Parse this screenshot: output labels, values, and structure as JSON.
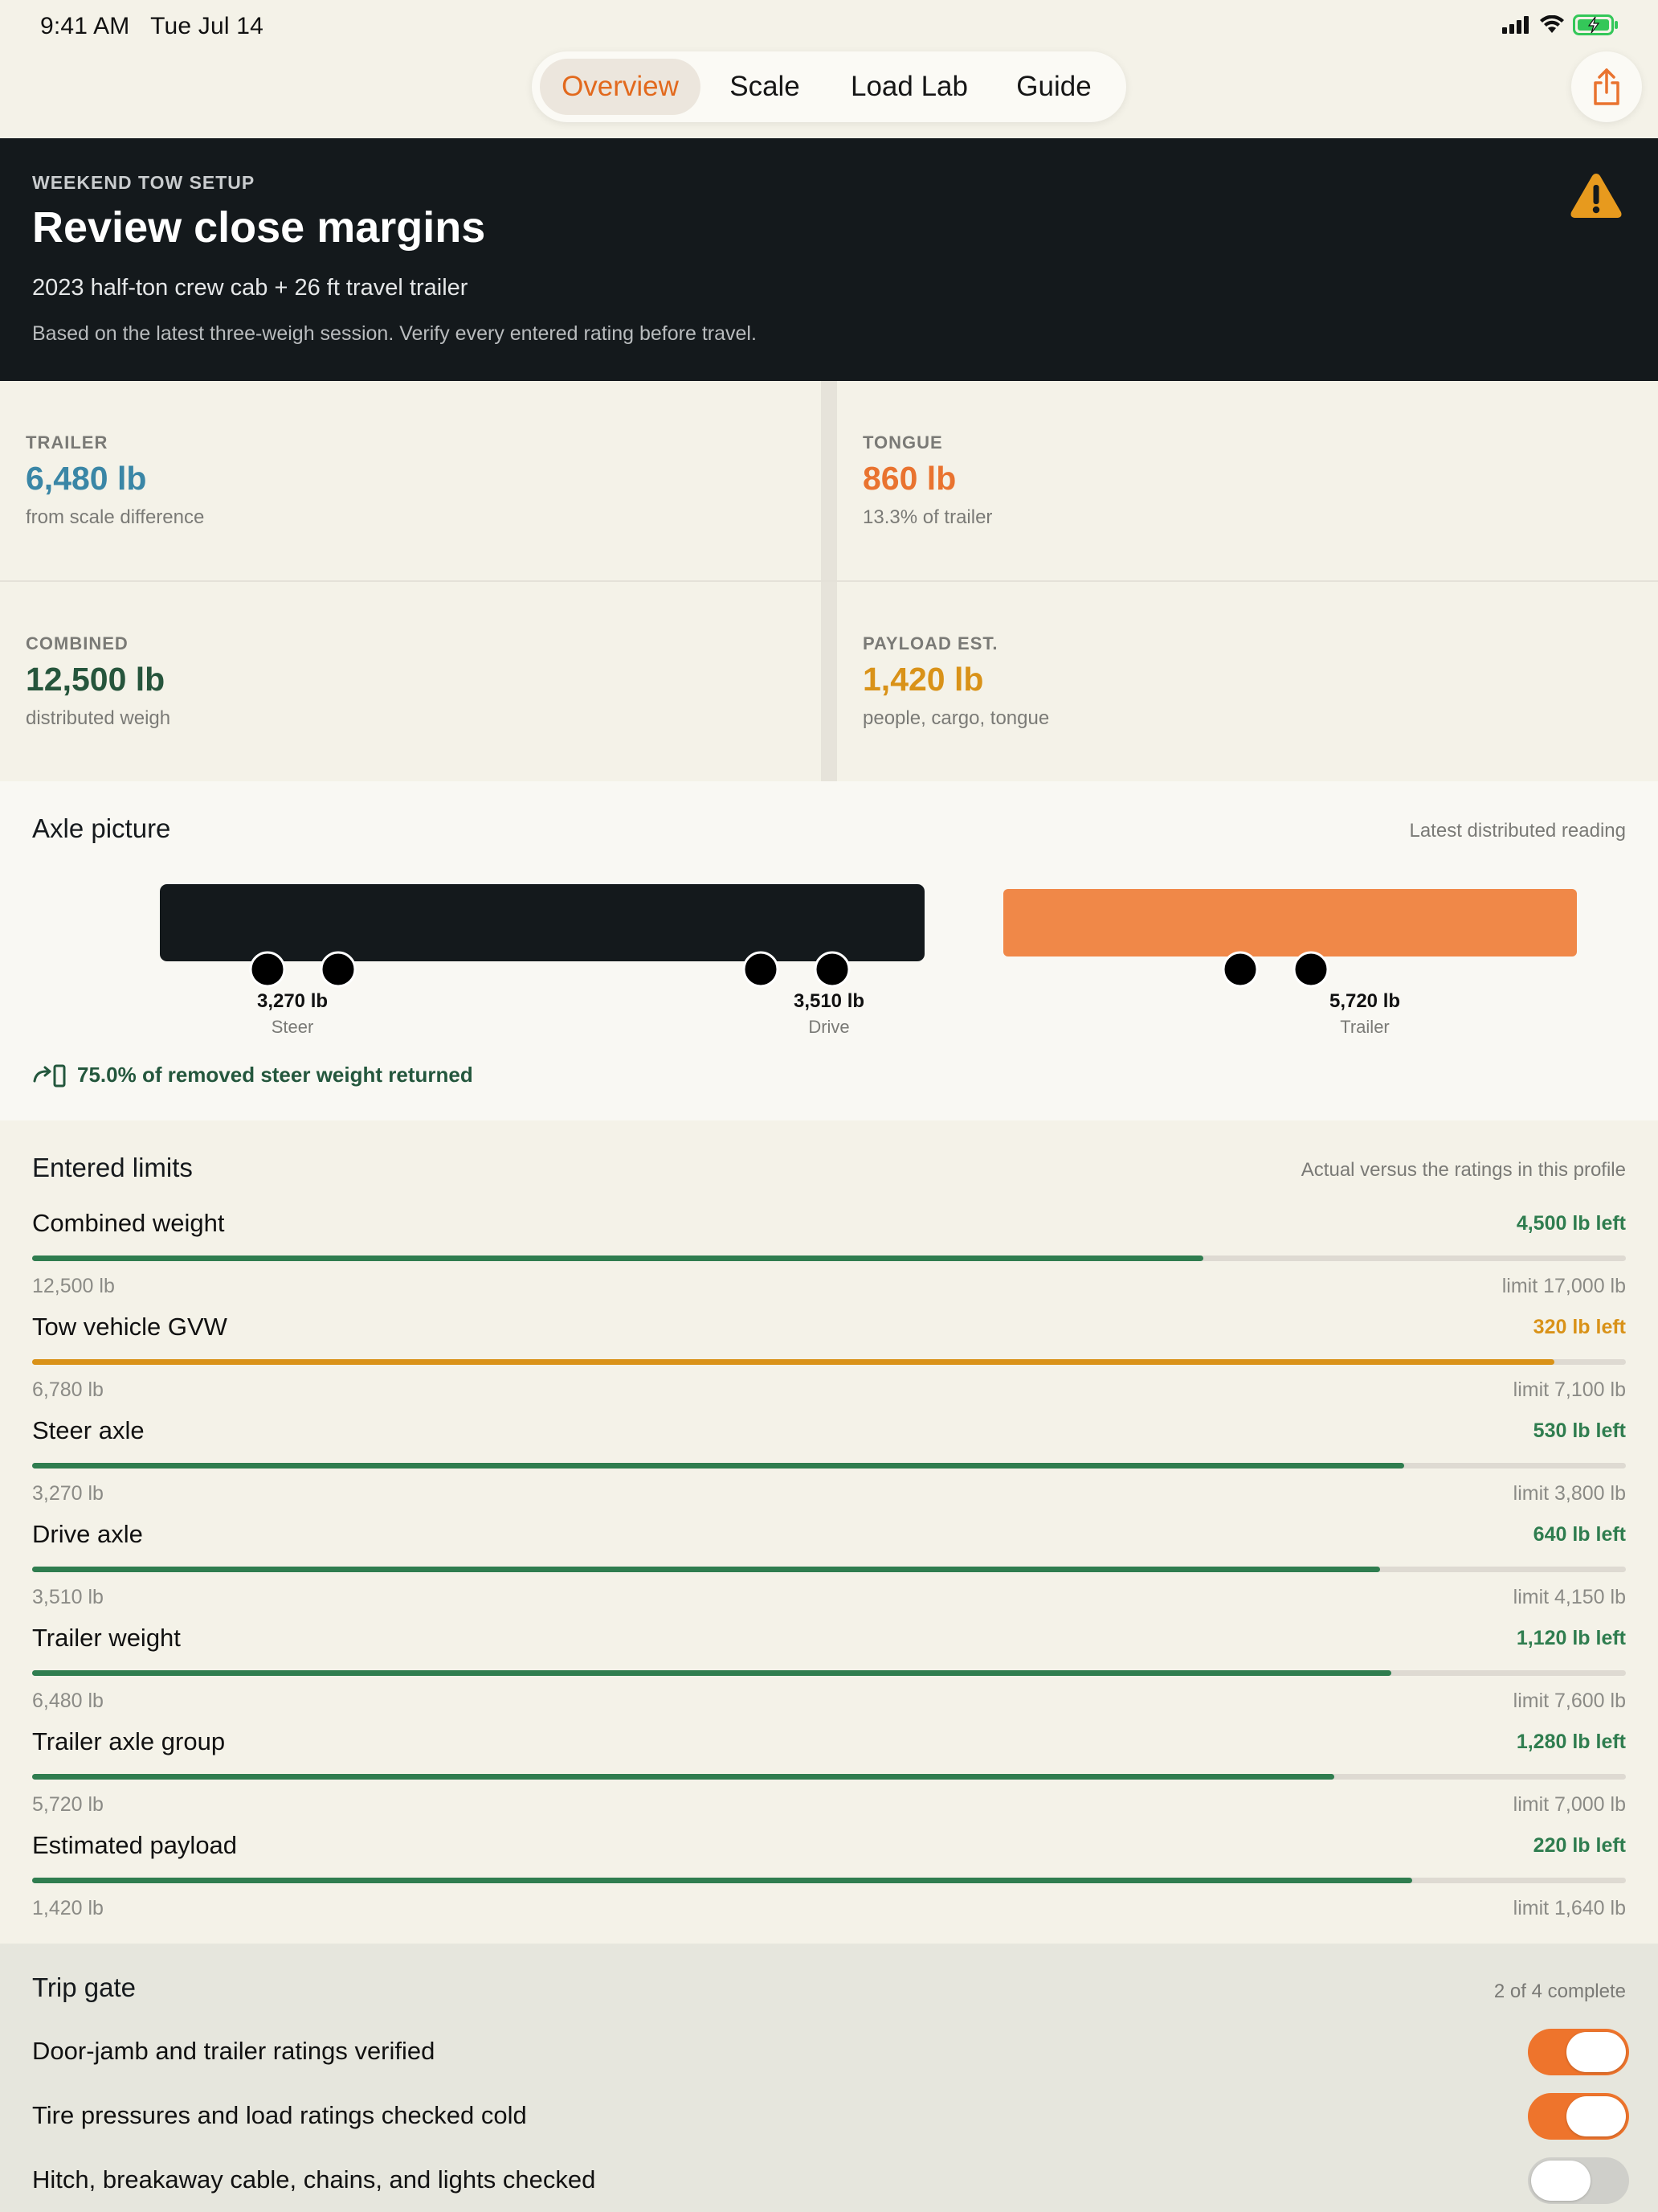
{
  "status": {
    "time": "9:41 AM",
    "date": "Tue Jul 14"
  },
  "nav": {
    "tabs": [
      {
        "label": "Overview",
        "active": true
      },
      {
        "label": "Scale",
        "active": false
      },
      {
        "label": "Load Lab",
        "active": false
      },
      {
        "label": "Guide",
        "active": false
      }
    ],
    "share_icon": "share-icon"
  },
  "hero": {
    "eyebrow": "WEEKEND TOW SETUP",
    "title": "Review close margins",
    "subtitle": "2023 half-ton crew cab + 26 ft travel trailer",
    "note": "Based on the latest three-weigh session. Verify every entered rating before travel.",
    "icon": "warning-icon"
  },
  "stats": [
    {
      "label": "TRAILER",
      "value": "6,480 lb",
      "sub": "from scale difference",
      "color": "#3a86a6"
    },
    {
      "label": "TONGUE",
      "value": "860 lb",
      "sub": "13.3% of trailer",
      "color": "#e9732f"
    },
    {
      "label": "COMBINED",
      "value": "12,500 lb",
      "sub": "distributed weigh",
      "color": "#26553c"
    },
    {
      "label": "PAYLOAD EST.",
      "value": "1,420 lb",
      "sub": "people, cargo, tongue",
      "color": "#d99218"
    }
  ],
  "axle": {
    "title": "Axle picture",
    "aside": "Latest distributed reading",
    "readings": [
      {
        "value": "3,270 lb",
        "label": "Steer"
      },
      {
        "value": "3,510 lb",
        "label": "Drive"
      },
      {
        "value": "5,720 lb",
        "label": "Trailer"
      }
    ],
    "returned": "75.0% of removed steer weight returned",
    "truck_color": "#14191c",
    "trailer_color": "#f08848"
  },
  "limits": {
    "title": "Entered limits",
    "aside": "Actual versus the ratings in this profile",
    "rows": [
      {
        "name": "Combined weight",
        "left": "4,500 lb left",
        "actual": "12,500 lb",
        "cap": "limit 17,000 lb",
        "fraction": 0.735,
        "color": "#2f7d4f"
      },
      {
        "name": "Tow vehicle GVW",
        "left": "320 lb left",
        "actual": "6,780 lb",
        "cap": "limit 7,100 lb",
        "fraction": 0.955,
        "color": "#d99218"
      },
      {
        "name": "Steer axle",
        "left": "530 lb left",
        "actual": "3,270 lb",
        "cap": "limit 3,800 lb",
        "fraction": 0.861,
        "color": "#2f7d4f"
      },
      {
        "name": "Drive axle",
        "left": "640 lb left",
        "actual": "3,510 lb",
        "cap": "limit 4,150 lb",
        "fraction": 0.846,
        "color": "#2f7d4f"
      },
      {
        "name": "Trailer weight",
        "left": "1,120 lb left",
        "actual": "6,480 lb",
        "cap": "limit 7,600 lb",
        "fraction": 0.853,
        "color": "#2f7d4f"
      },
      {
        "name": "Trailer axle group",
        "left": "1,280 lb left",
        "actual": "5,720 lb",
        "cap": "limit 7,000 lb",
        "fraction": 0.817,
        "color": "#2f7d4f"
      },
      {
        "name": "Estimated payload",
        "left": "220 lb left",
        "actual": "1,420 lb",
        "cap": "limit 1,640 lb",
        "fraction": 0.866,
        "color": "#2f7d4f"
      }
    ]
  },
  "gate": {
    "title": "Trip gate",
    "aside": "2 of 4 complete",
    "items": [
      {
        "label": "Door-jamb and trailer ratings verified",
        "on": true
      },
      {
        "label": "Tire pressures and load ratings checked cold",
        "on": true
      },
      {
        "label": "Hitch, breakaway cable, chains, and lights checked",
        "on": false
      }
    ]
  }
}
